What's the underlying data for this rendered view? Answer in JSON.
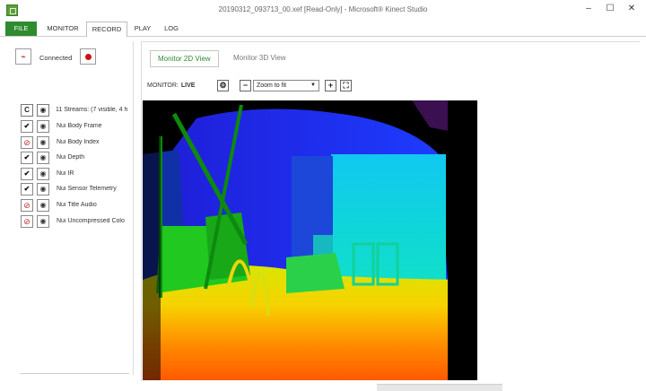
{
  "window": {
    "title": "20190312_093713_00.xef [Read-Only] - Microsoft® Kinect Studio",
    "minimize": "–",
    "maximize": "☐",
    "close": "✕"
  },
  "menu": {
    "file": "FILE",
    "monitor": "MONITOR",
    "record": "RECORD",
    "play": "PLAY",
    "log": "LOG"
  },
  "left_panel": {
    "connected_label": "Connected",
    "c_label": "C",
    "streams_summary": "11 Streams: (7 visible, 4 h",
    "streams": [
      {
        "name": "Nui Body Frame",
        "state": "check"
      },
      {
        "name": "Nui Body Index",
        "state": "block"
      },
      {
        "name": "Nui Depth",
        "state": "check"
      },
      {
        "name": "Nui IR",
        "state": "check"
      },
      {
        "name": "Nui Sensor Telemetry",
        "state": "check"
      },
      {
        "name": "Nui Title Audio",
        "state": "block"
      },
      {
        "name": "Nui Uncompressed Colo",
        "state": "block"
      }
    ]
  },
  "main": {
    "tab_2d": "Monitor 2D View",
    "tab_3d": "Monitor 3D View",
    "monitor_label": "MONITOR:",
    "monitor_mode": "LIVE",
    "zoom_value": "Zoom to fit",
    "accent": "#2e8b2e"
  },
  "icons": {
    "gear": "⚙",
    "minus": "−",
    "plus": "+",
    "fit": "⛶",
    "check": "✔",
    "block": "⊘",
    "eye": "◉",
    "caret": "▼",
    "plug": "⌁"
  }
}
